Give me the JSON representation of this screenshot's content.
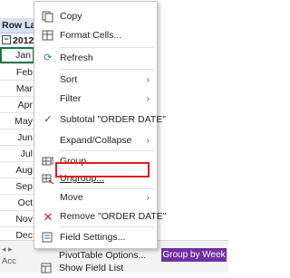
{
  "sheet": {
    "row_labels_header": "Row Lab",
    "year": "2012",
    "months": [
      "Jan",
      "Feb",
      "Mar",
      "Apr",
      "May",
      "Jun",
      "Jul",
      "Aug",
      "Sep",
      "Oct",
      "Nov",
      "Dec"
    ],
    "group_by_week": "Group by Week",
    "status_text": "Acc"
  },
  "menu": {
    "copy": "Copy",
    "format_cells": "Format Cells...",
    "refresh": "Refresh",
    "sort": "Sort",
    "filter": "Filter",
    "subtotal": "Subtotal \"ORDER DATE\"",
    "expand_collapse": "Expand/Collapse",
    "group": "Group...",
    "ungroup": "Ungroup...",
    "move": "Move",
    "remove": "Remove \"ORDER DATE\"",
    "field_settings": "Field Settings...",
    "pivot_options": "PivotTable Options...",
    "show_field_list": "Show Field List"
  },
  "colors": {
    "highlight": "#e21b1b",
    "accent": "#7030a0",
    "selection": "#217346"
  }
}
